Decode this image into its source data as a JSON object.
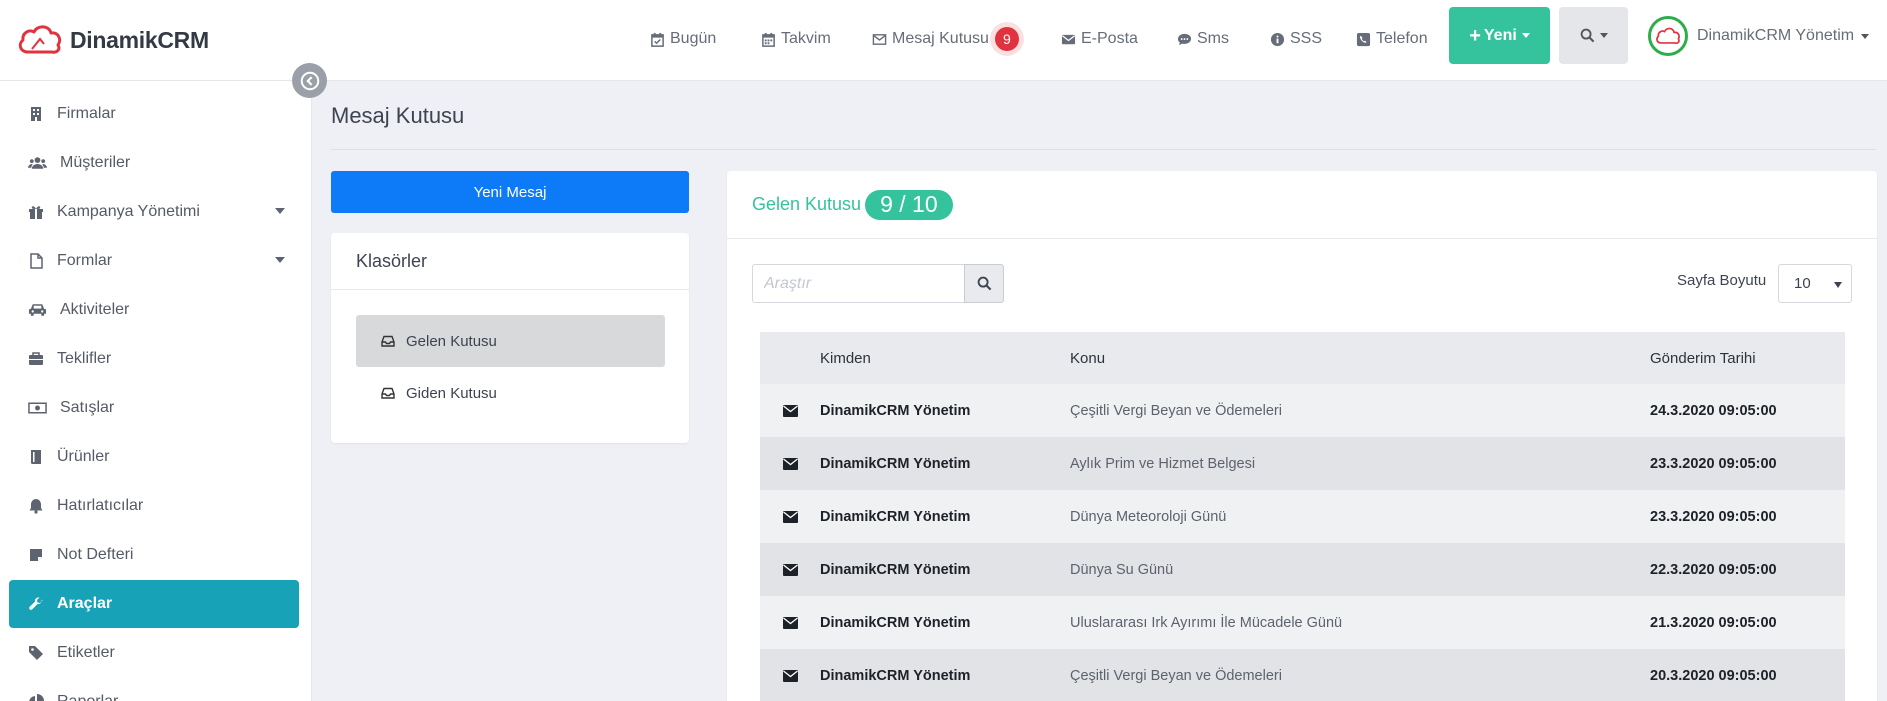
{
  "brand": {
    "name": "DinamikCRM",
    "color": "#e0333f"
  },
  "topnav": [
    {
      "id": "bugun",
      "label": "Bugün",
      "icon": "calendar-check-icon"
    },
    {
      "id": "takvim",
      "label": "Takvim",
      "icon": "calendar-icon"
    },
    {
      "id": "mesaj",
      "label": "Mesaj Kutusu",
      "icon": "envelope-outline-icon",
      "badge": "9"
    },
    {
      "id": "eposta",
      "label": "E-Posta",
      "icon": "envelope-icon"
    },
    {
      "id": "sms",
      "label": "Sms",
      "icon": "chat-bubble-icon"
    },
    {
      "id": "sss",
      "label": "SSS",
      "icon": "info-circle-icon"
    },
    {
      "id": "telefon",
      "label": "Telefon",
      "icon": "phone-icon"
    }
  ],
  "new_button": {
    "label": "Yeni",
    "color": "#34c39c"
  },
  "user": {
    "name": "DinamikCRM Yönetim"
  },
  "sidebar": {
    "items": [
      {
        "label": "Firmalar",
        "icon": "building-icon"
      },
      {
        "label": "Müşteriler",
        "icon": "users-icon"
      },
      {
        "label": "Kampanya Yönetimi",
        "icon": "gift-icon",
        "submenu": true
      },
      {
        "label": "Formlar",
        "icon": "file-icon",
        "submenu": true
      },
      {
        "label": "Aktiviteler",
        "icon": "car-icon"
      },
      {
        "label": "Teklifler",
        "icon": "briefcase-icon"
      },
      {
        "label": "Satışlar",
        "icon": "money-icon"
      },
      {
        "label": "Ürünler",
        "icon": "book-icon"
      },
      {
        "label": "Hatırlatıcılar",
        "icon": "bell-icon"
      },
      {
        "label": "Not Defteri",
        "icon": "sticky-note-icon"
      },
      {
        "label": "Araçlar",
        "icon": "wrench-icon",
        "active": true
      },
      {
        "label": "Etiketler",
        "icon": "tag-icon"
      },
      {
        "label": "Raporlar",
        "icon": "chart-pie-icon"
      }
    ],
    "active_color": "#17a2b8"
  },
  "page": {
    "title": "Mesaj Kutusu"
  },
  "compose": {
    "label": "Yeni Mesaj",
    "color": "#0d7bf7"
  },
  "folders": {
    "title": "Klasörler",
    "items": [
      {
        "label": "Gelen Kutusu",
        "icon": "inbox-icon",
        "active": true
      },
      {
        "label": "Giden Kutusu",
        "icon": "inbox-icon"
      }
    ]
  },
  "inbox": {
    "title": "Gelen Kutusu",
    "count": "9 / 10",
    "search_placeholder": "Araştır",
    "page_size_label": "Sayfa Boyutu",
    "page_size": "10",
    "columns": {
      "from": "Kimden",
      "subject": "Konu",
      "date": "Gönderim Tarihi"
    },
    "rows": [
      {
        "from": "DinamikCRM Yönetim",
        "subject": "Çeşitli Vergi Beyan ve Ödemeleri",
        "date": "24.3.2020 09:05:00"
      },
      {
        "from": "DinamikCRM Yönetim",
        "subject": "Aylık Prim ve Hizmet Belgesi",
        "date": "23.3.2020 09:05:00"
      },
      {
        "from": "DinamikCRM Yönetim",
        "subject": "Dünya Meteoroloji Günü",
        "date": "23.3.2020 09:05:00"
      },
      {
        "from": "DinamikCRM Yönetim",
        "subject": "Dünya Su Günü",
        "date": "22.3.2020 09:05:00"
      },
      {
        "from": "DinamikCRM Yönetim",
        "subject": "Uluslararası Irk Ayırımı İle Mücadele Günü",
        "date": "21.3.2020 09:05:00"
      },
      {
        "from": "DinamikCRM Yönetim",
        "subject": "Çeşitli Vergi Beyan ve Ödemeleri",
        "date": "20.3.2020 09:05:00"
      }
    ]
  }
}
